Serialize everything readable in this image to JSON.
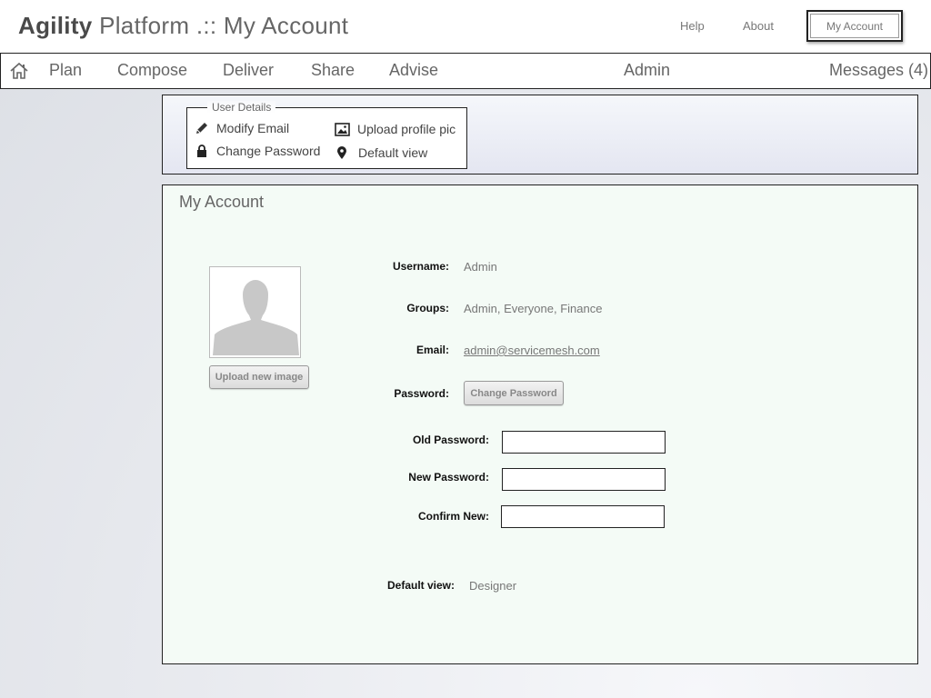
{
  "header": {
    "brand_bold": "Agility",
    "brand_rest": "Platform .:: My Account",
    "help_label": "Help",
    "about_label": "About",
    "account_label": "My Account"
  },
  "nav": {
    "home_icon": "home-icon",
    "items": [
      "Plan",
      "Compose",
      "Deliver",
      "Share",
      "Advise"
    ],
    "admin_label": "Admin",
    "messages_label": "Messages (4)"
  },
  "user_details": {
    "legend": "User Details",
    "modify_email": "Modify Email",
    "change_password": "Change Password",
    "upload_pic": "Upload profile pic",
    "default_view": "Default view",
    "icons": [
      "pencil-icon",
      "lock-icon",
      "image-icon",
      "map-pin-icon"
    ]
  },
  "account": {
    "title": "My Account",
    "upload_button": "Upload new image",
    "username_label": "Username:",
    "username_value": "Admin",
    "groups_label": "Groups:",
    "groups_value": "Admin, Everyone, Finance",
    "email_label": "Email:",
    "email_value": "admin@servicemesh.com",
    "password_label": "Password:",
    "change_password_button": "Change Password",
    "old_password_label": "Old Password:",
    "new_password_label": "New Password:",
    "confirm_label": "Confirm New:",
    "old_password_value": "",
    "new_password_value": "",
    "confirm_value": "",
    "default_view_label": "Default view:",
    "default_view_value": "Designer"
  }
}
